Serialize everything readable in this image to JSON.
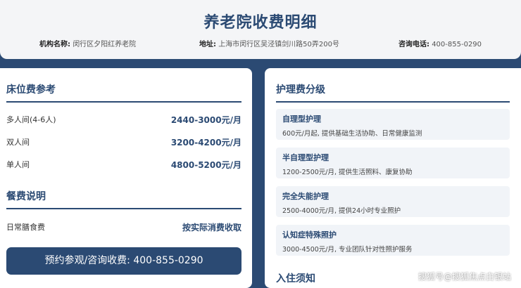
{
  "header": {
    "title": "养老院收费明细",
    "org_label": "机构名称:",
    "org_value": "闵行区夕阳红养老院",
    "addr_label": "地址:",
    "addr_value": "上海市闵行区吴泾镇剑川路50弄200号",
    "phone_label": "咨询电话:",
    "phone_value": "400-855-0290"
  },
  "bed": {
    "title": "床位费参考",
    "rows": [
      {
        "label": "多人间(4-6人)",
        "value": "2440-3000元/月"
      },
      {
        "label": "双人间",
        "value": "3200-4200元/月"
      },
      {
        "label": "单人间",
        "value": "4800-5200元/月"
      }
    ]
  },
  "meal": {
    "title": "餐费说明",
    "rows": [
      {
        "label": "日常膳食费",
        "value": "按实际消费收取"
      }
    ]
  },
  "cta_label": "预约参观/咨询收费: 400-855-0290",
  "care": {
    "title": "护理费分级",
    "levels": [
      {
        "name": "自理型护理",
        "desc": "600元/月起, 提供基础生活协助、日常健康监测"
      },
      {
        "name": "半自理型护理",
        "desc": "1200-2500元/月, 提供生活照料、康复协助"
      },
      {
        "name": "完全失能护理",
        "desc": "2500-4000元/月, 提供24小时专业照护"
      },
      {
        "name": "认知症特殊照护",
        "desc": "3000-4500元/月, 专业团队针对性照护服务"
      }
    ]
  },
  "admission_title": "入住须知",
  "watermark": "搜狐号@搜狐焦点白银站"
}
